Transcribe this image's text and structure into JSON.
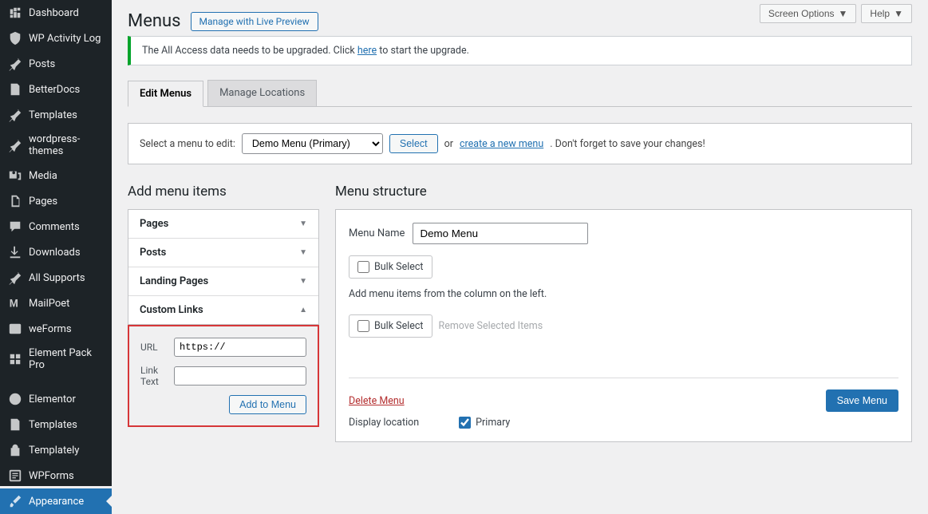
{
  "top_buttons": {
    "screen_options": "Screen Options",
    "help": "Help"
  },
  "sidebar": {
    "items": [
      {
        "label": "Dashboard",
        "name": "dashboard"
      },
      {
        "label": "WP Activity Log",
        "name": "wp-activity-log"
      },
      {
        "label": "Posts",
        "name": "posts"
      },
      {
        "label": "BetterDocs",
        "name": "betterdocs"
      },
      {
        "label": "Templates",
        "name": "templates"
      },
      {
        "label": "wordpress-themes",
        "name": "wordpress-themes"
      },
      {
        "label": "Media",
        "name": "media"
      },
      {
        "label": "Pages",
        "name": "pages"
      },
      {
        "label": "Comments",
        "name": "comments"
      },
      {
        "label": "Downloads",
        "name": "downloads"
      },
      {
        "label": "All Supports",
        "name": "all-supports"
      },
      {
        "label": "MailPoet",
        "name": "mailpoet"
      },
      {
        "label": "weForms",
        "name": "weforms"
      },
      {
        "label": "Element Pack Pro",
        "name": "element-pack-pro"
      },
      {
        "label": "Elementor",
        "name": "elementor"
      },
      {
        "label": "Templates",
        "name": "templates-2"
      },
      {
        "label": "Templately",
        "name": "templately"
      },
      {
        "label": "WPForms",
        "name": "wpforms"
      },
      {
        "label": "Appearance",
        "name": "appearance"
      }
    ]
  },
  "page": {
    "title": "Menus",
    "preview_link": "Manage with Live Preview"
  },
  "notice": {
    "text_before": "The All Access data needs to be upgraded. Click ",
    "link": "here",
    "text_after": " to start the upgrade."
  },
  "tabs": {
    "edit": "Edit Menus",
    "locations": "Manage Locations"
  },
  "select_bar": {
    "label": "Select a menu to edit:",
    "selected": "Demo Menu (Primary)",
    "select_btn": "Select",
    "or": "or",
    "create_link": "create a new menu",
    "suffix": ". Don't forget to save your changes!"
  },
  "left": {
    "heading": "Add menu items",
    "boxes": [
      "Pages",
      "Posts",
      "Landing Pages",
      "Custom Links"
    ],
    "url_label": "URL",
    "url_value": "https://",
    "text_label": "Link Text",
    "text_value": "",
    "add_btn": "Add to Menu"
  },
  "right": {
    "heading": "Menu structure",
    "name_label": "Menu Name",
    "name_value": "Demo Menu",
    "bulk_select": "Bulk Select",
    "instruction": "Add menu items from the column on the left.",
    "remove_link": "Remove Selected Items",
    "delete_link": "Delete Menu",
    "save_btn": "Save Menu",
    "display_label": "Display location",
    "primary_label": "Primary"
  }
}
